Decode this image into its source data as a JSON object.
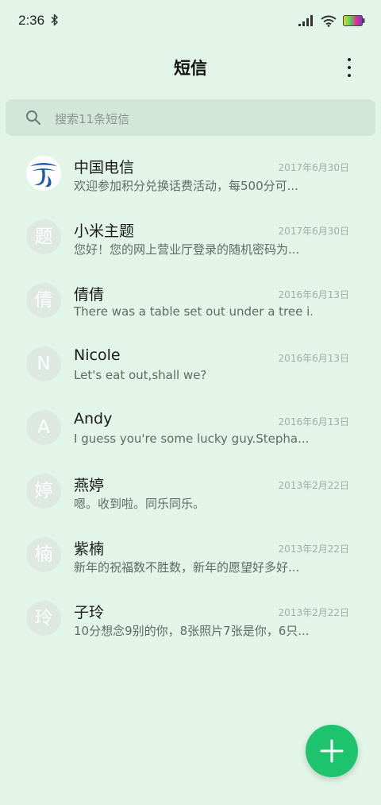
{
  "status_bar": {
    "time": "2:36",
    "icons": [
      "bluetooth-icon",
      "signal-icon",
      "wifi-icon",
      "battery-icon"
    ]
  },
  "header": {
    "title": "短信",
    "menu_icon": "more-vert-icon"
  },
  "search": {
    "placeholder": "搜索11条短信",
    "icon": "search-icon"
  },
  "conversations": [
    {
      "name": "中国电信",
      "date": "2017年6月30日",
      "preview": "欢迎参加积分兑换话费活动，每500分可...",
      "avatar_type": "logo",
      "avatar_icon": "china-telecom-logo"
    },
    {
      "name": "小米主题",
      "date": "2017年6月30日",
      "preview": "您好！您的网上营业厅登录的随机密码为...",
      "avatar": "题"
    },
    {
      "name": "倩倩",
      "date": "2016年6月13日",
      "preview": "There was a table set out under a tree i...",
      "avatar": "倩"
    },
    {
      "name": "Nicole",
      "date": "2016年6月13日",
      "preview": "Let's eat out,shall we?",
      "avatar": "N"
    },
    {
      "name": "Andy",
      "date": "2016年6月13日",
      "preview": "I guess you're some lucky guy.Stepha...",
      "avatar": "A"
    },
    {
      "name": "燕婷",
      "date": "2013年2月22日",
      "preview": "嗯。收到啦。同乐同乐。",
      "avatar": "婷"
    },
    {
      "name": "紫楠",
      "date": "2013年2月22日",
      "preview": "新年的祝福数不胜数，新年的愿望好多好...",
      "avatar": "楠"
    },
    {
      "name": "子玲",
      "date": "2013年2月22日",
      "preview": "10分想念9别的你，8张照片7张是你，6只...",
      "avatar": "玲"
    }
  ],
  "fab": {
    "icon": "plus-icon",
    "color": "#1ec46d"
  },
  "colors": {
    "background": "#e2f5e8",
    "search_bg": "#d3e6da",
    "avatar_bg": "#dde8e1",
    "accent": "#1ec46d",
    "telecom_blue": "#1e5aa8"
  }
}
